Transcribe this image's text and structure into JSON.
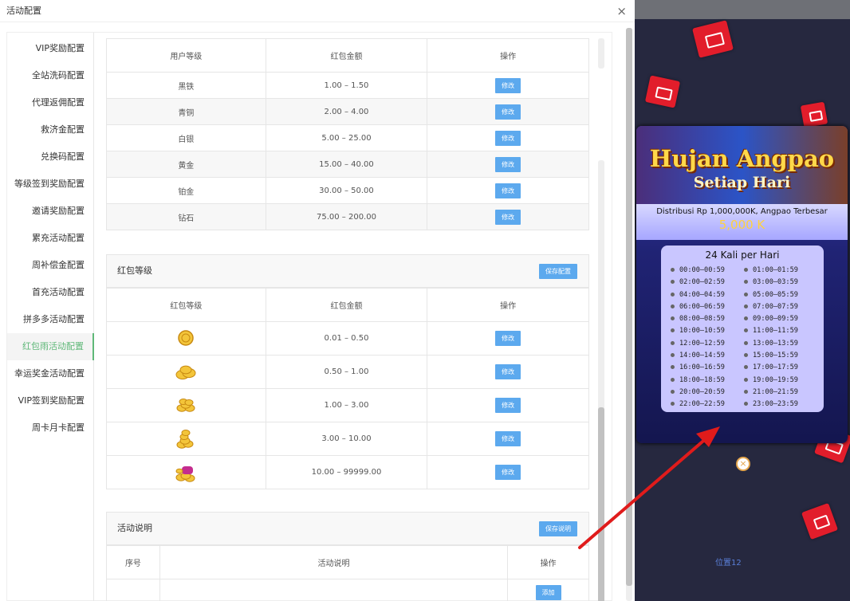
{
  "modal": {
    "title": "活动配置",
    "close_glyph": "×"
  },
  "sidebar": [
    "VIP奖励配置",
    "全站洗码配置",
    "代理返佣配置",
    "救济金配置",
    "兑换码配置",
    "等级签到奖励配置",
    "邀请奖励配置",
    "累充活动配置",
    "周补偿金配置",
    "首充活动配置",
    "拼多多活动配置",
    "红包雨活动配置",
    "幸运奖金活动配置",
    "VIP签到奖励配置",
    "周卡月卡配置"
  ],
  "active_sidebar": "红包雨活动配置",
  "user_level_table": {
    "headers": [
      "用户等级",
      "红包金额",
      "操作"
    ],
    "rows": [
      {
        "level": "黑铁",
        "amount": "1.00 – 1.50",
        "action": "修改"
      },
      {
        "level": "青铜",
        "amount": "2.00 – 4.00",
        "action": "修改"
      },
      {
        "level": "白银",
        "amount": "5.00 – 25.00",
        "action": "修改"
      },
      {
        "level": "黄金",
        "amount": "15.00 – 40.00",
        "action": "修改"
      },
      {
        "level": "铂金",
        "amount": "30.00 – 50.00",
        "action": "修改"
      },
      {
        "level": "钻石",
        "amount": "75.00 – 200.00",
        "action": "修改"
      }
    ]
  },
  "packet_level": {
    "title": "红包等级",
    "save_label": "保存配置",
    "headers": [
      "红包等级",
      "红包金额",
      "操作"
    ],
    "rows": [
      {
        "icon": "single-coin-icon",
        "amount": "0.01 – 0.50",
        "action": "修改"
      },
      {
        "icon": "coin-pile-icon",
        "amount": "0.50 – 1.00",
        "action": "修改"
      },
      {
        "icon": "coin-heap-icon",
        "amount": "1.00 – 3.00",
        "action": "修改"
      },
      {
        "icon": "coin-stack-icon",
        "amount": "3.00 – 10.00",
        "action": "修改"
      },
      {
        "icon": "treasure-coins-icon",
        "amount": "10.00 – 99999.00",
        "action": "修改"
      }
    ]
  },
  "activity_desc": {
    "title": "活动说明",
    "save_label": "保存说明",
    "headers": [
      "序号",
      "活动说明",
      "操作"
    ],
    "add_label": "添加"
  },
  "banner": {
    "title1": "Hujan Angpao",
    "title2": "Setiap Hari",
    "distrib": "Distribusi Rp 1,000,000K, Angpao Terbesar",
    "biggest": "5,000 K",
    "sched_title": "24 Kali per Hari",
    "slots": [
      "00:00–00:59",
      "01:00–01:59",
      "02:00–02:59",
      "03:00–03:59",
      "04:00–04:59",
      "05:00–05:59",
      "06:00–06:59",
      "07:00–07:59",
      "08:00–08:59",
      "09:00–09:59",
      "10:00–10:59",
      "11:00–11:59",
      "12:00–12:59",
      "13:00–13:59",
      "14:00–14:59",
      "15:00–15:59",
      "16:00–16:59",
      "17:00–17:59",
      "18:00–18:59",
      "19:00–19:59",
      "20:00–20:59",
      "21:00–21:59",
      "22:00–22:59",
      "23:00–23:59"
    ],
    "close_glyph": "×"
  },
  "bg_label": "位置12",
  "colors": {
    "accent": "#5fb878",
    "button": "#5ca9ee",
    "arrow": "#e01b1b",
    "angpao": "#e21d2b"
  }
}
